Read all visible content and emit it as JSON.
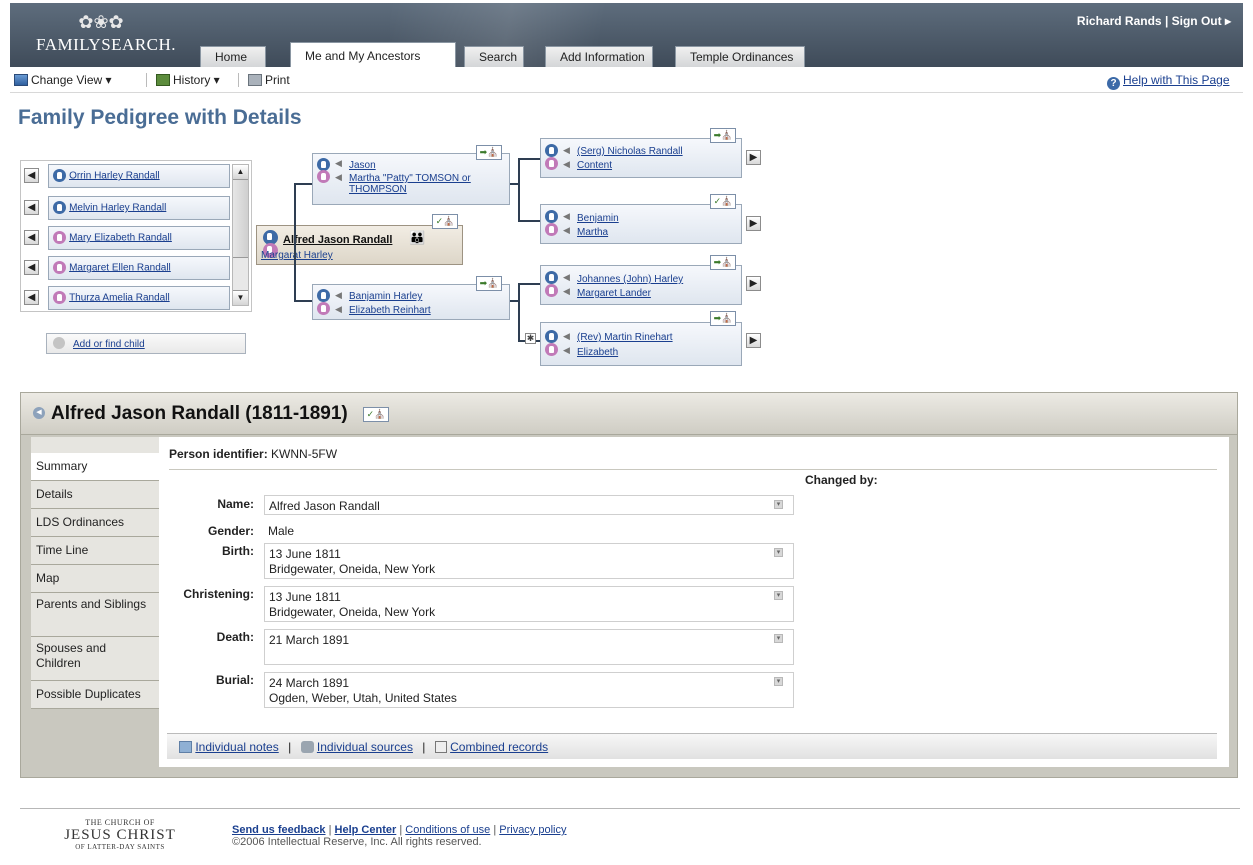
{
  "header": {
    "logo": "FAMILYSEARCH.",
    "user": "Richard Rands",
    "sign_out": "Sign Out ▸",
    "separator": "|",
    "tabs": [
      "Home",
      "Me and My Ancestors",
      "Search",
      "Add Information",
      "Temple Ordinances"
    ],
    "active_tab": "Me and My Ancestors"
  },
  "toolbar": {
    "change_view": "Change View ▾",
    "history": "History ▾",
    "print": "Print",
    "help": "Help with This Page"
  },
  "page_title": "Family Pedigree with Details",
  "children": [
    {
      "name": "Orrin Harley Randall",
      "gender": "m"
    },
    {
      "name": "Melvin Harley Randall",
      "gender": "m"
    },
    {
      "name": "Mary Elizabeth Randall",
      "gender": "f"
    },
    {
      "name": "Margaret Ellen Randall",
      "gender": "f"
    },
    {
      "name": "Thurza Amelia Randall",
      "gender": "f"
    }
  ],
  "add_child": "Add or find child",
  "focus": {
    "name": "Alfred Jason Randall",
    "spouse": "Margarat Harley"
  },
  "parents_father": {
    "husband": "Jason",
    "wife": "Martha \"Patty\" TOMSON or THOMPSON"
  },
  "parents_mother": {
    "husband": "Banjamin Harley",
    "wife": "Elizabeth Reinhart"
  },
  "gp": [
    {
      "husband": "(Serg) Nicholas Randall",
      "wife": "Content"
    },
    {
      "husband": "Benjamin",
      "wife": "Martha"
    },
    {
      "husband": "Johannes (John) Harley",
      "wife": "Margaret Lander"
    },
    {
      "husband": "(Rev) Martin Rinehart",
      "wife": "Elizabeth"
    }
  ],
  "detail": {
    "heading": "Alfred Jason Randall (1811-1891)",
    "tabs": [
      "Summary",
      "Details",
      "LDS Ordinances",
      "Time Line",
      "Map",
      "Parents and Siblings",
      "Spouses and Children",
      "Possible Duplicates"
    ],
    "identifier_label": "Person identifier:",
    "identifier": "KWNN-5FW",
    "changed_by": "Changed by:",
    "fields": {
      "name_label": "Name:",
      "name": "Alfred Jason Randall",
      "gender_label": "Gender:",
      "gender": "Male",
      "birth_label": "Birth:",
      "birth_date": "13 June 1811",
      "birth_place": "Bridgewater, Oneida, New York",
      "christening_label": "Christening:",
      "christening_date": "13 June 1811",
      "christening_place": "Bridgewater, Oneida, New York",
      "death_label": "Death:",
      "death_date": "21 March 1891",
      "burial_label": "Burial:",
      "burial_date": "24 March 1891",
      "burial_place": "Ogden, Weber, Utah, United States"
    },
    "links": {
      "notes": "Individual notes",
      "sources": "Individual sources",
      "combined": "Combined records",
      "sep": "|"
    }
  },
  "footer": {
    "church_line1": "THE CHURCH OF",
    "church_line2": "JESUS CHRIST",
    "church_line3": "OF LATTER-DAY SAINTS",
    "feedback": "Send us feedback",
    "help_center": "Help Center",
    "conditions": "Conditions of use",
    "privacy": "Privacy policy",
    "copyright": "©2006 Intellectual Reserve, Inc. All rights reserved."
  }
}
